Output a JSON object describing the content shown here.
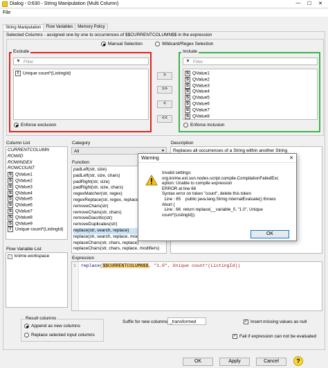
{
  "window": {
    "title": "Dialog - 0:630 - String Manipulation (Multi Column)",
    "minimize": "—",
    "maximize": "☐",
    "close": "✕"
  },
  "menu": {
    "file": "File"
  },
  "tabs": [
    "String Manipulation",
    "Flow Variables",
    "Memory Policy"
  ],
  "selected_columns_label": "Selected Columns - assigned one by one to occurrences of $$CURRENTCOLUMN$$ in the expression",
  "selection_modes": {
    "manual": "Manual Selection",
    "wildcard": "Wildcard/Regex Selection"
  },
  "exclude": {
    "title": "Exclude",
    "filter_placeholder": "Filter",
    "items": [
      "Unique count*(ListingId)"
    ],
    "enforce": "Enforce exclusion"
  },
  "include": {
    "title": "Include",
    "filter_placeholder": "Filter",
    "items": [
      "QValue1",
      "QValue2",
      "QValue3",
      "QValue4",
      "QValue5",
      "QValue6",
      "QValue7",
      "QValue8"
    ],
    "enforce": "Enforce inclusion"
  },
  "move_buttons": [
    ">",
    ">>",
    "<",
    "<<"
  ],
  "column_list": {
    "title": "Column List",
    "special": [
      "CURRENTCOLUMN",
      "ROWID",
      "ROWINDEX",
      "ROWCOUNT"
    ],
    "items": [
      "QValue1",
      "QValue2",
      "QValue3",
      "QValue4",
      "QValue5",
      "QValue6",
      "QValue7",
      "QValue8",
      "QValue9",
      "Unique count*(ListingId)"
    ]
  },
  "flow_variable_list": {
    "title": "Flow Variable List",
    "items": [
      "knime.workspace"
    ]
  },
  "category": {
    "title": "Category",
    "selected": "All"
  },
  "function": {
    "title": "Function",
    "items": [
      "padLeft(str, size)",
      "padLeft(str, size, chars)",
      "padRight(str, size)",
      "padRight(str, size, chars)",
      "regexMatcher(str, regex)",
      "regexReplace(str, regex, replaceSt",
      "removeChars(str)",
      "removeChars(str, chars)",
      "removeDiacritic(str)",
      "removeDuplicates(str)",
      "replace(str, search, replace)",
      "replace(str, search, replace, modifie",
      "replaceChars(str, chars, replace)",
      "replaceChars(str, chars, replace, modifiers)"
    ],
    "selected_index": 10
  },
  "description": {
    "title": "Description",
    "text": "Replaces all occurrences of a String within another String"
  },
  "expression": {
    "title": "Expression",
    "line_no": "1",
    "code_fn": "replace(",
    "code_var": "$$CURRENTCOLUMN$$",
    "code_rest": ", \"1.0\", Unique count*(ListingId))"
  },
  "result_columns": {
    "title": "Result columns",
    "append": "Append as new columns",
    "replace": "Replace selected input columns"
  },
  "suffix": {
    "label": "Suffix for new columns",
    "value": "_transformed"
  },
  "insert_missing": "Insert missing values as null",
  "fail_on_error": "Fail if expression can not be evaluated",
  "buttons": {
    "ok": "OK",
    "apply": "Apply",
    "cancel": "Cancel"
  },
  "warning": {
    "title": "Warning",
    "lines": [
      "Invalid settings:",
      "org.knime.ext.sun.nodes.script.compile.CompilationFailedExc",
      "eption: Unable to compile expression",
      "ERROR at line 66",
      "Syntax error on token \"count\", delete this token",
      "  Line : 65    public java.lang.String internalEvaluate() throws",
      "Abort {",
      "  Line : 66  return replace(__variable_0, \"1.0\", Unique",
      "count*(ListingId));"
    ],
    "ok": "OK",
    "icon": "warning-triangle-icon"
  },
  "colors": {
    "exclude_border": "#d9241c",
    "include_border": "#3bb34a",
    "selection": "#cce4f7",
    "accent": "#0078d7"
  }
}
